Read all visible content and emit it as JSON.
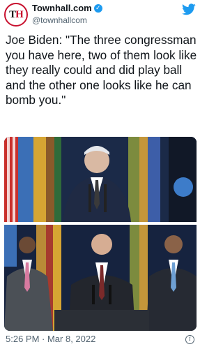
{
  "tweet": {
    "avatar_text": "TH",
    "display_name": "Townhall.com",
    "handle": "@townhallcom",
    "text": "Joe Biden: \"The three congressman you have here, two of them look like they really could and did play ball and the other one looks like he can bomb you.\"",
    "timestamp": "5:26 PM · Mar 8, 2022"
  },
  "icons": {
    "verified": "verified-badge-icon",
    "brand": "twitter-bird-icon",
    "info": "info-icon"
  },
  "colors": {
    "verified_blue": "#1d9bf0",
    "twitter_blue": "#1d9bf0",
    "secondary_text": "#536471",
    "brand_red": "#c8102e"
  }
}
